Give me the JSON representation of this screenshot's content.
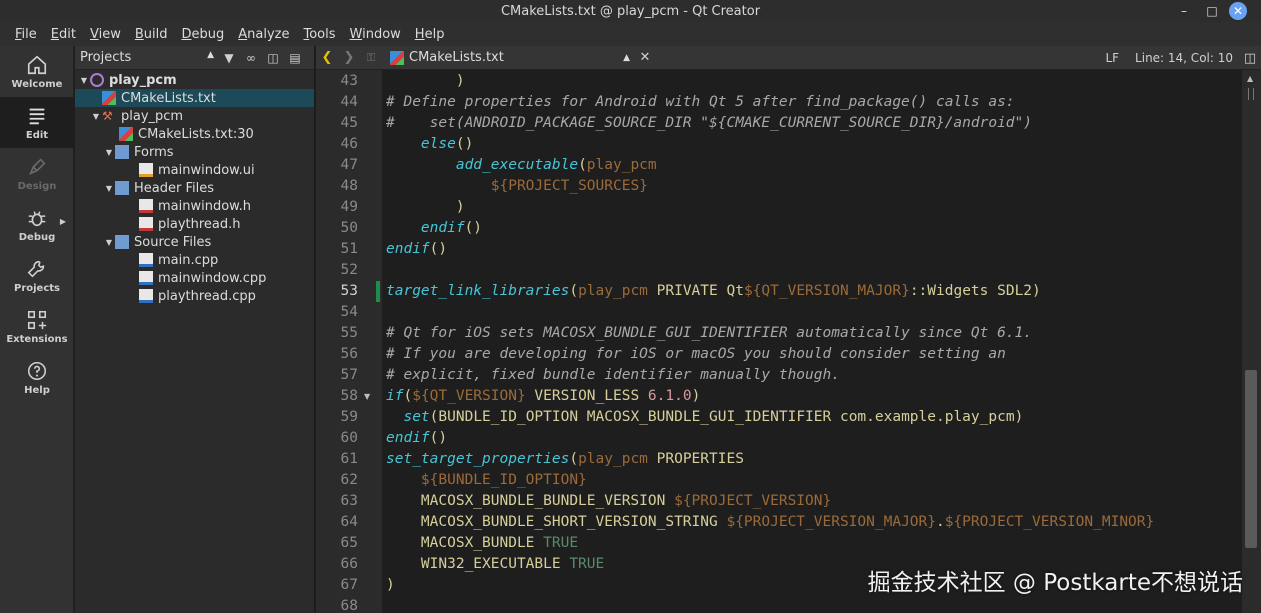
{
  "window": {
    "title": "CMakeLists.txt @ play_pcm - Qt Creator"
  },
  "menu": [
    "File",
    "Edit",
    "View",
    "Build",
    "Debug",
    "Analyze",
    "Tools",
    "Window",
    "Help"
  ],
  "modes": [
    {
      "label": "Welcome",
      "icon": "home-icon"
    },
    {
      "label": "Edit",
      "icon": "edit-document-icon"
    },
    {
      "label": "Design",
      "icon": "pen-icon"
    },
    {
      "label": "Debug",
      "icon": "bug-icon"
    },
    {
      "label": "Projects",
      "icon": "wrench-icon"
    },
    {
      "label": "Extensions",
      "icon": "extensions-icon"
    },
    {
      "label": "Help",
      "icon": "help-icon"
    }
  ],
  "projects_pane": {
    "combo": "Projects",
    "tree": [
      {
        "label": "play_pcm"
      },
      {
        "label": "CMakeLists.txt"
      },
      {
        "label": "play_pcm"
      },
      {
        "label": "CMakeLists.txt:30"
      },
      {
        "label": "Forms"
      },
      {
        "label": "mainwindow.ui"
      },
      {
        "label": "Header Files"
      },
      {
        "label": "mainwindow.h"
      },
      {
        "label": "playthread.h"
      },
      {
        "label": "Source Files"
      },
      {
        "label": "main.cpp"
      },
      {
        "label": "mainwindow.cpp"
      },
      {
        "label": "playthread.cpp"
      }
    ]
  },
  "editor": {
    "file": "CMakeLists.txt",
    "line_ending": "LF",
    "cursor": "Line: 14, Col: 10",
    "lines": [
      {
        "n": "43",
        "segs": [
          {
            "t": "        )",
            "c": "c-text"
          }
        ]
      },
      {
        "n": "44",
        "segs": [
          {
            "t": "# Define properties for Android with Qt 5 after find_package() calls as:",
            "c": "c-comment"
          }
        ]
      },
      {
        "n": "45",
        "segs": [
          {
            "t": "#    set(ANDROID_PACKAGE_SOURCE_DIR \"${CMAKE_CURRENT_SOURCE_DIR}/android\")",
            "c": "c-comment"
          }
        ]
      },
      {
        "n": "46",
        "segs": [
          {
            "t": "    ",
            "c": "c-text"
          },
          {
            "t": "else",
            "c": "c-func"
          },
          {
            "t": "()",
            "c": "c-text"
          }
        ]
      },
      {
        "n": "47",
        "segs": [
          {
            "t": "        ",
            "c": "c-text"
          },
          {
            "t": "add_executable",
            "c": "c-func"
          },
          {
            "t": "(",
            "c": "c-text"
          },
          {
            "t": "play_pcm",
            "c": "c-var"
          }
        ]
      },
      {
        "n": "48",
        "segs": [
          {
            "t": "            ",
            "c": "c-text"
          },
          {
            "t": "${PROJECT_SOURCES}",
            "c": "c-var"
          }
        ]
      },
      {
        "n": "49",
        "segs": [
          {
            "t": "        )",
            "c": "c-text"
          }
        ]
      },
      {
        "n": "50",
        "segs": [
          {
            "t": "    ",
            "c": "c-text"
          },
          {
            "t": "endif",
            "c": "c-func"
          },
          {
            "t": "()",
            "c": "c-text"
          }
        ]
      },
      {
        "n": "51",
        "segs": [
          {
            "t": "endif",
            "c": "c-func"
          },
          {
            "t": "()",
            "c": "c-text"
          }
        ]
      },
      {
        "n": "52",
        "segs": []
      },
      {
        "n": "53",
        "segs": [
          {
            "t": "target_link_libraries",
            "c": "c-func"
          },
          {
            "t": "(",
            "c": "c-text"
          },
          {
            "t": "play_pcm",
            "c": "c-var"
          },
          {
            "t": " PRIVATE Qt",
            "c": "c-text"
          },
          {
            "t": "${QT_VERSION_MAJOR}",
            "c": "c-var"
          },
          {
            "t": "::Widgets SDL2)",
            "c": "c-text"
          }
        ]
      },
      {
        "n": "54",
        "segs": []
      },
      {
        "n": "55",
        "segs": [
          {
            "t": "# Qt for iOS sets MACOSX_BUNDLE_GUI_IDENTIFIER automatically since Qt 6.1.",
            "c": "c-comment"
          }
        ]
      },
      {
        "n": "56",
        "segs": [
          {
            "t": "# If you are developing for iOS or macOS you should consider setting an",
            "c": "c-comment"
          }
        ]
      },
      {
        "n": "57",
        "segs": [
          {
            "t": "# explicit, fixed bundle identifier manually though.",
            "c": "c-comment"
          }
        ]
      },
      {
        "n": "58",
        "segs": [
          {
            "t": "if",
            "c": "c-func"
          },
          {
            "t": "(",
            "c": "c-text"
          },
          {
            "t": "${QT_VERSION}",
            "c": "c-var"
          },
          {
            "t": " VERSION_LESS ",
            "c": "c-text"
          },
          {
            "t": "6.1.0",
            "c": "c-num"
          },
          {
            "t": ")",
            "c": "c-text"
          }
        ]
      },
      {
        "n": "59",
        "segs": [
          {
            "t": "  ",
            "c": "c-text"
          },
          {
            "t": "set",
            "c": "c-func"
          },
          {
            "t": "(BUNDLE_ID_OPTION MACOSX_BUNDLE_GUI_IDENTIFIER com.example.play_pcm)",
            "c": "c-text"
          }
        ]
      },
      {
        "n": "60",
        "segs": [
          {
            "t": "endif",
            "c": "c-func"
          },
          {
            "t": "()",
            "c": "c-text"
          }
        ]
      },
      {
        "n": "61",
        "segs": [
          {
            "t": "set_target_properties",
            "c": "c-func"
          },
          {
            "t": "(",
            "c": "c-text"
          },
          {
            "t": "play_pcm",
            "c": "c-var"
          },
          {
            "t": " PROPERTIES",
            "c": "c-text"
          }
        ]
      },
      {
        "n": "62",
        "segs": [
          {
            "t": "    ",
            "c": "c-text"
          },
          {
            "t": "${BUNDLE_ID_OPTION}",
            "c": "c-var"
          }
        ]
      },
      {
        "n": "63",
        "segs": [
          {
            "t": "    MACOSX_BUNDLE_BUNDLE_VERSION ",
            "c": "c-text"
          },
          {
            "t": "${PROJECT_VERSION}",
            "c": "c-var"
          }
        ]
      },
      {
        "n": "64",
        "segs": [
          {
            "t": "    MACOSX_BUNDLE_SHORT_VERSION_STRING ",
            "c": "c-text"
          },
          {
            "t": "${PROJECT_VERSION_MAJOR}",
            "c": "c-var"
          },
          {
            "t": ".",
            "c": "c-text"
          },
          {
            "t": "${PROJECT_VERSION_MINOR}",
            "c": "c-var"
          }
        ]
      },
      {
        "n": "65",
        "segs": [
          {
            "t": "    MACOSX_BUNDLE ",
            "c": "c-text"
          },
          {
            "t": "TRUE",
            "c": "c-true"
          }
        ]
      },
      {
        "n": "66",
        "segs": [
          {
            "t": "    WIN32_EXECUTABLE ",
            "c": "c-text"
          },
          {
            "t": "TRUE",
            "c": "c-true"
          }
        ]
      },
      {
        "n": "67",
        "segs": [
          {
            "t": ")",
            "c": "c-text"
          }
        ]
      },
      {
        "n": "68",
        "segs": []
      }
    ]
  },
  "watermark": "掘金技术社区 @ Postkarte不想说话"
}
